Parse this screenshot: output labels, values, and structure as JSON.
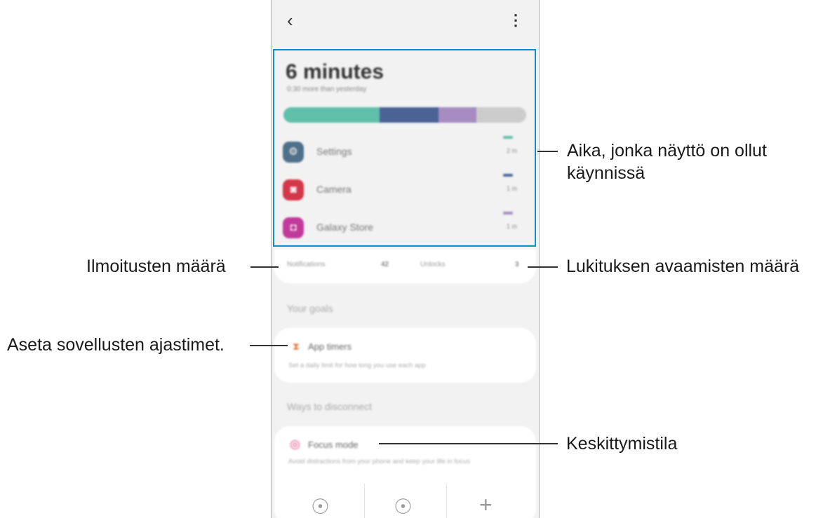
{
  "phone": {
    "back_glyph": "‹",
    "more_glyph": "⋮",
    "screen_time": "6 minutes",
    "screen_time_sub": "0:30 more than yesterday",
    "usage_bar": [
      {
        "fraction": 0.395,
        "color": "#5fbfa9"
      },
      {
        "fraction": 0.245,
        "color": "#4a6394"
      },
      {
        "fraction": 0.155,
        "color": "#a68cc1"
      },
      {
        "fraction": 0.205,
        "color": "#cccccc"
      }
    ],
    "apps": [
      {
        "name": "Settings",
        "time": "2 m",
        "icon": "gear-icon",
        "glyph": "⚙",
        "icon_color": "#4f7088",
        "bar_color": "#5fbfa9"
      },
      {
        "name": "Camera",
        "time": "1 m",
        "icon": "camera-icon",
        "glyph": "◙",
        "icon_color": "#d4364a",
        "bar_color": "#4a6394"
      },
      {
        "name": "Galaxy Store",
        "time": "1 m",
        "icon": "shopping-bag-icon",
        "glyph": "◘",
        "icon_color": "#c13a9a",
        "bar_color": "#a68cc1"
      }
    ],
    "stats": {
      "notifications_label": "Notifications",
      "notifications_value": "42",
      "unlocks_label": "Unlocks",
      "unlocks_value": "3"
    },
    "goals_title": "Your goals",
    "app_timers": {
      "title": "App timers",
      "desc": "Set a daily limit for how long you use each app",
      "icon": "hourglass-icon",
      "glyph": "⧗",
      "icon_color": "#e8733b"
    },
    "disconnect_title": "Ways to disconnect",
    "focus_mode": {
      "title": "Focus mode",
      "desc": "Avoid distractions from your phone and keep your life in focus",
      "icon": "target-icon",
      "glyph": "◎",
      "icon_color": "#e0397b"
    },
    "bottom_icons": [
      {
        "icon": "focus-work-icon",
        "glyph": "☉"
      },
      {
        "icon": "focus-study-icon",
        "glyph": "☉"
      },
      {
        "icon": "add-icon",
        "glyph": "+"
      }
    ]
  },
  "callouts": {
    "screen_time": "Aika, jonka näyttö on ollut käynnissä",
    "screen_time_line2": "käynnissä",
    "notifications": "Ilmoitusten määrä",
    "unlocks": "Lukituksen avaamisten määrä",
    "app_timers": "Aseta sovellusten ajastimet.",
    "focus_mode": "Keskittymistila"
  },
  "colors": {
    "highlight": "#1a8ac9"
  }
}
